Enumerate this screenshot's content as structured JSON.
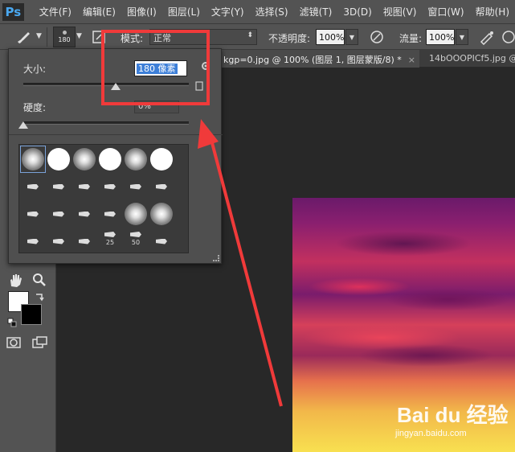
{
  "app": {
    "logo": "Ps",
    "menu": [
      "文件(F)",
      "编辑(E)",
      "图像(I)",
      "图层(L)",
      "文字(Y)",
      "选择(S)",
      "滤镜(T)",
      "3D(D)",
      "视图(V)",
      "窗口(W)",
      "帮助(H)"
    ]
  },
  "options_bar": {
    "brush_size_preview": "180",
    "mode_label": "模式:",
    "mode_value": "正常",
    "opacity_label": "不透明度:",
    "opacity_value": "100%",
    "flow_label": "流量:",
    "flow_value": "100%"
  },
  "tabs": [
    {
      "label": "kgp=0.jpg @ 100% (图层 1, 图层蒙版/8) *",
      "close": "×",
      "active": true
    },
    {
      "label": "14bOOOPICf5.jpg @",
      "close": "",
      "active": false
    }
  ],
  "brush_popup": {
    "size_label": "大小:",
    "size_value": "180 像素",
    "size_fraction": 0.56,
    "hardness_label": "硬度:",
    "hardness_value": "0%",
    "hardness_fraction": 0.0,
    "preset_labels": [
      "25",
      "50"
    ]
  },
  "watermark": {
    "brand": "Bai du 经验",
    "site": "jingyan.baidu.com"
  },
  "colors": {
    "highlight": "#f03a3a",
    "panel": "#535353",
    "canvas_bg": "#282828",
    "selection": "#3d7fd8"
  }
}
